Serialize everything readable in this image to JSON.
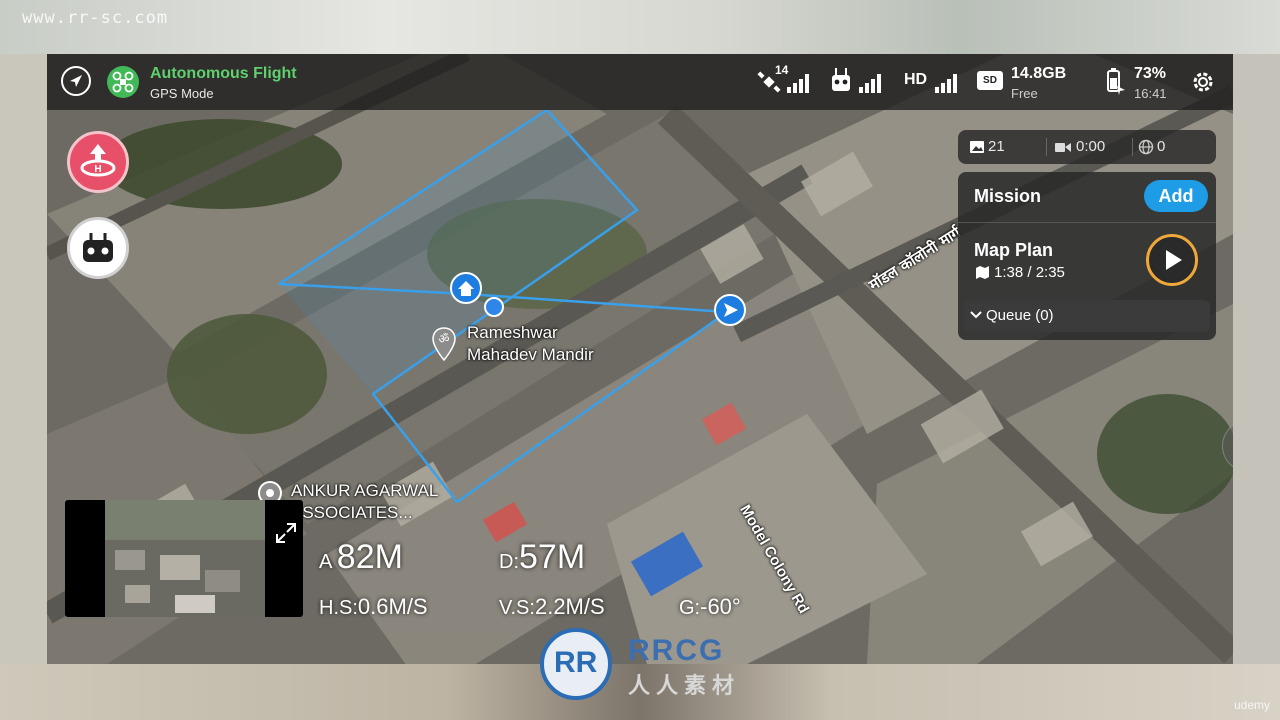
{
  "watermarks": {
    "top": "www.rr-sc.com",
    "bottom_right": "udemy",
    "brand": "RRCG",
    "brand_sub": "人人素材"
  },
  "topbar": {
    "flight_mode": "Autonomous Flight",
    "gps_mode": "GPS Mode",
    "satellites": "14",
    "video_link": "HD",
    "sd_label": "SD",
    "storage_free": "14.8GB",
    "storage_free_label": "Free",
    "battery": "73%",
    "time": "16:41"
  },
  "media": {
    "photos": "21",
    "video_time": "0:00",
    "other": "0"
  },
  "mission": {
    "title": "Mission",
    "add_label": "Add",
    "plan_name": "Map Plan",
    "plan_time": "1:38 / 2:35",
    "queue_label": "Queue (0)"
  },
  "map": {
    "poi_1_line1": "Rameshwar",
    "poi_1_line2": "Mahadev Mandir",
    "poi_2_line1": "ANKUR AGARWAL",
    "poi_2_line2": "ASSOCIATES...",
    "road_1": "Model Colony Rd",
    "road_2": "मॉडल कॉलोनी मार्ग"
  },
  "telemetry": {
    "altitude_label": "A",
    "altitude": "82M",
    "distance_label": "D",
    "distance": "57M",
    "hspeed_label": "H.S:",
    "hspeed": "0.6M/S",
    "vspeed_label": "V.S:",
    "vspeed": "2.2M/S",
    "gimbal_label": "G:",
    "gimbal": "-60°"
  },
  "colors": {
    "accent": "#1e9de6",
    "gps_green": "#41b957",
    "rth_pink": "#e8506a",
    "play_ring": "#f0a83a",
    "flight_path": "#3aa0ea"
  }
}
